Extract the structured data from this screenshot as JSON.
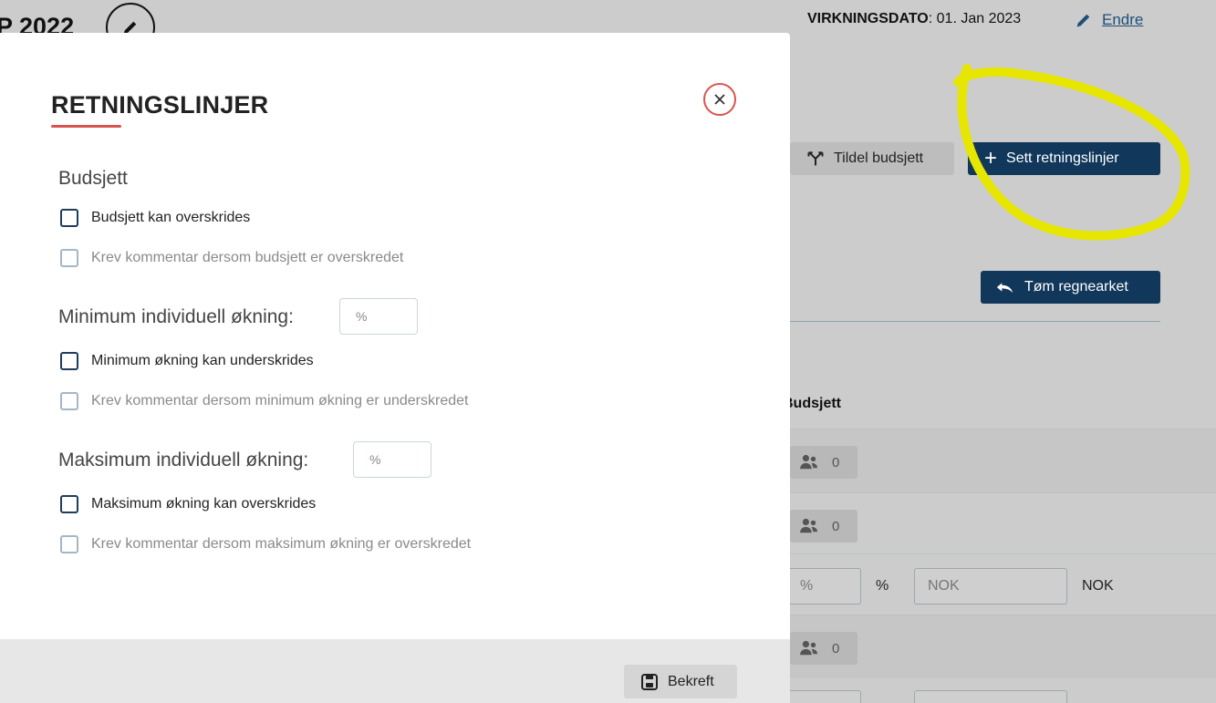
{
  "background": {
    "title_fragment": "P 2022",
    "virkningsdato_label": "VIRKNINGSDATO",
    "virkningsdato_value": ": 01. Jan 2023",
    "endre_label": "Endre",
    "tildel_budsjett_label": "Tildel budsjett",
    "sett_retningslinjer_label": "Sett retningslinjer",
    "tom_regnearket_label": "Tøm regnearket",
    "budsjett_column_header": "Budsjett",
    "rows": [
      {
        "count": "0"
      },
      {
        "count": "0"
      },
      {
        "pct_placeholder": "%",
        "pct_unit": "%",
        "nok_placeholder": "NOK",
        "nok_unit": "NOK"
      },
      {
        "count": "0"
      }
    ],
    "highlight_color": "#e6e600"
  },
  "modal": {
    "title": "RETNINGSLINJER",
    "sections": {
      "budsjett": {
        "label": "Budsjett",
        "can_exceed": "Budsjett kan overskrides",
        "require_comment": "Krev kommentar dersom budsjett er overskredet"
      },
      "minimum": {
        "label": "Minimum individuell økning:",
        "input_placeholder": "%",
        "can_exceed": "Minimum økning kan underskrides",
        "require_comment": "Krev kommentar dersom minimum økning er underskredet"
      },
      "maksimum": {
        "label": "Maksimum individuell økning:",
        "input_placeholder": "%",
        "can_exceed": "Maksimum økning kan overskrides",
        "require_comment": "Krev kommentar dersom maksimum økning er overskredet"
      }
    },
    "confirm_label": "Bekreft",
    "accent_color": "#d9534f",
    "checkbox_color": "#1f3d5c"
  }
}
